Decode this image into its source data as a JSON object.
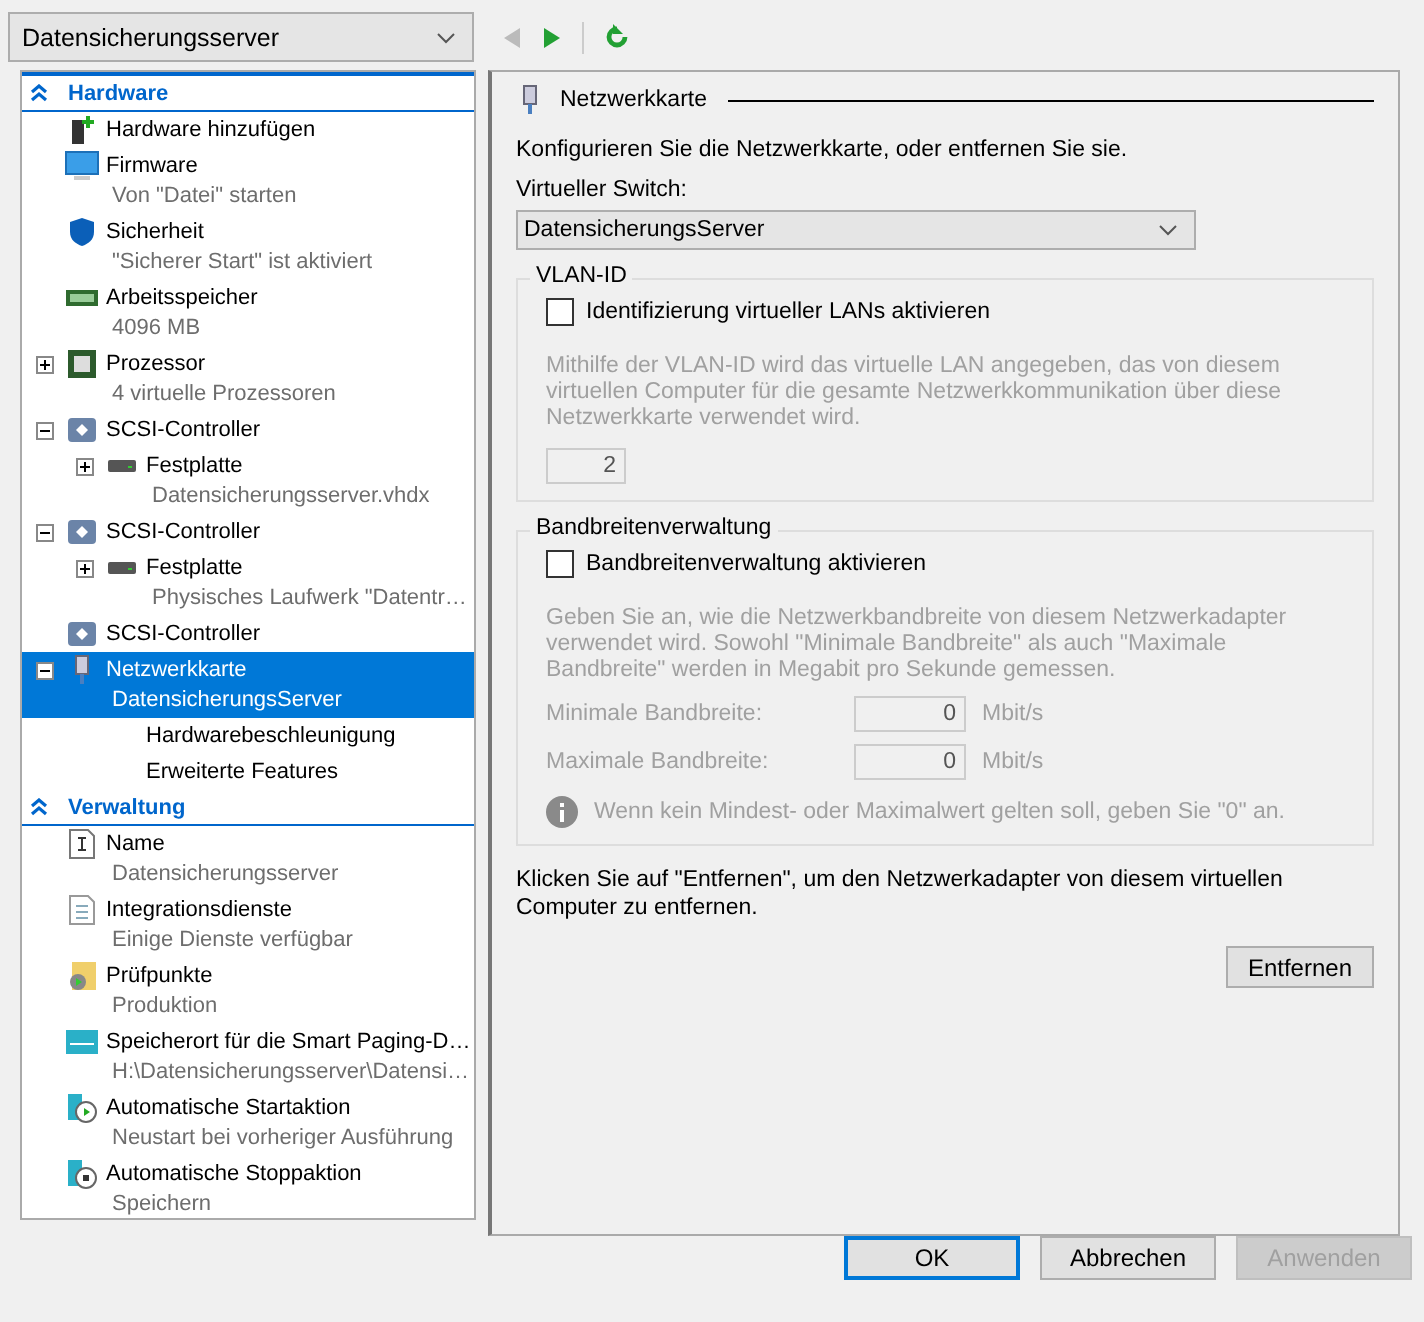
{
  "vm_selector": {
    "value": "Datensicherungsserver"
  },
  "tree": [
    {
      "label": "Hardware",
      "expanded": true,
      "children": [
        {
          "label": "Hardware hinzufügen",
          "selected": false
        },
        {
          "label": "Firmware",
          "detail": "Von \"Datei\" starten",
          "selected": false
        },
        {
          "label": "Sicherheit",
          "detail": "\"Sicherer Start\" ist aktiviert",
          "selected": false
        },
        {
          "label": "Arbeitsspeicher",
          "detail": "4096 MB",
          "selected": false
        },
        {
          "label": "Prozessor",
          "detail": "4 virtuelle Prozessoren",
          "expanded": false,
          "selected": false
        },
        {
          "label": "SCSI-Controller",
          "expanded": true,
          "selected": false,
          "children": [
            {
              "label": "Festplatte",
              "detail": "Datensicherungsserver.vhdx",
              "expanded": false,
              "selected": false
            }
          ]
        },
        {
          "label": "SCSI-Controller",
          "expanded": true,
          "selected": false,
          "children": [
            {
              "label": "Festplatte",
              "detail": "Physisches Laufwerk \"Datentr…",
              "expanded": false,
              "selected": false
            }
          ]
        },
        {
          "label": "SCSI-Controller",
          "selected": false
        },
        {
          "label": "Netzwerkkarte",
          "detail": "DatensicherungsServer",
          "expanded": true,
          "selected": true,
          "children": [
            {
              "label": "Hardwarebeschleunigung",
              "selected": false
            },
            {
              "label": "Erweiterte Features",
              "selected": false
            }
          ]
        }
      ]
    },
    {
      "label": "Verwaltung",
      "expanded": true,
      "children": [
        {
          "label": "Name",
          "detail": "Datensicherungsserver",
          "selected": false
        },
        {
          "label": "Integrationsdienste",
          "detail": "Einige Dienste verfügbar",
          "selected": false
        },
        {
          "label": "Prüfpunkte",
          "detail": "Produktion",
          "selected": false
        },
        {
          "label": "Speicherort für die Smart Paging-D…",
          "detail": "H:\\Datensicherungsserver\\Datensi…",
          "selected": false
        },
        {
          "label": "Automatische Startaktion",
          "detail": "Neustart bei vorheriger Ausführung",
          "selected": false
        },
        {
          "label": "Automatische Stoppaktion",
          "detail": "Speichern",
          "selected": false
        }
      ]
    }
  ],
  "panel": {
    "title": "Netzwerkkarte",
    "intro": "Konfigurieren Sie die Netzwerkkarte, oder entfernen Sie sie.",
    "switch_label": "Virtueller Switch:",
    "switch_value": "DatensicherungsServer",
    "vlan": {
      "title": "VLAN-ID",
      "checkbox": "Identifizierung virtueller LANs aktivieren",
      "checked": false,
      "description": "Mithilfe der VLAN-ID wird das virtuelle LAN angegeben, das von diesem virtuellen Computer für die gesamte Netzwerkkommunikation über diese Netzwerkkarte verwendet wird.",
      "value": "2"
    },
    "bandwidth": {
      "title": "Bandbreitenverwaltung",
      "checkbox": "Bandbreitenverwaltung aktivieren",
      "checked": false,
      "description": "Geben Sie an, wie die Netzwerkbandbreite von diesem Netzwerkadapter verwendet wird. Sowohl \"Minimale Bandbreite\" als auch \"Maximale Bandbreite\" werden in Megabit pro Sekunde gemessen.",
      "fields": [
        {
          "label": "Minimale Bandbreite:",
          "value": "0",
          "unit": "Mbit/s"
        },
        {
          "label": "Maximale Bandbreite:",
          "value": "0",
          "unit": "Mbit/s"
        }
      ],
      "info": "Wenn kein Mindest- oder Maximalwert gelten soll, geben Sie \"0\" an."
    },
    "remove_text": "Klicken Sie auf \"Entfernen\", um den Netzwerkadapter von diesem virtuellen Computer zu entfernen.",
    "remove_button": "Entfernen"
  },
  "buttons": [
    {
      "label": "OK",
      "default": true,
      "disabled": false
    },
    {
      "label": "Abbrechen",
      "default": false,
      "disabled": false
    },
    {
      "label": "Anwenden",
      "default": false,
      "disabled": true
    }
  ]
}
